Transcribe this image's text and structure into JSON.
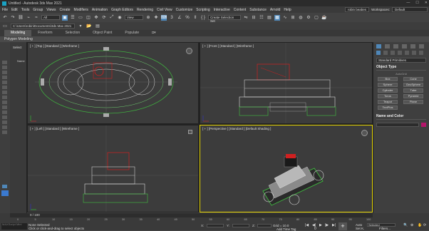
{
  "window": {
    "title": "Untitled - Autodesk 3ds Max 2021",
    "controls": [
      "—",
      "☐",
      "✕"
    ]
  },
  "menu": {
    "items": [
      "File",
      "Edit",
      "Tools",
      "Group",
      "Views",
      "Create",
      "Modifiers",
      "Animation",
      "Graph Editors",
      "Rendering",
      "Civil View",
      "Customize",
      "Scripting",
      "Interactive",
      "Content",
      "Substance",
      "Arnold",
      "Help"
    ],
    "user": "robin beabes",
    "workspace_label": "Workspaces:",
    "workspace_value": "Default"
  },
  "toolbar": {
    "filter_value": "All",
    "view_value": "View",
    "selection_set_placeholder": "Create Selection Set"
  },
  "project": {
    "path": "C:\\Users\\robin\\Documents\\3ds Max 2021"
  },
  "ribbon": {
    "tabs": [
      "Modeling",
      "Freeform",
      "Selection",
      "Object Paint",
      "Populate"
    ],
    "active_tab": "Modeling",
    "sub_label": "Polygon Modeling"
  },
  "scene_explorer": {
    "tag": "Select",
    "name_header": "Name"
  },
  "viewports": {
    "top_label": "[ + ] [Top ] [Standard ] [Wireframe ]",
    "front_label": "[ + ] [Front ] [Standard ] [Wireframe ]",
    "left_label": "[ + ] [Left ] [Standard ] [Wireframe ]",
    "persp_label": "[ + ] [Perspective ] [Standard ] [Default Shading ]"
  },
  "command_panel": {
    "category": "Standard Primitives",
    "object_type_title": "Object Type",
    "autogrid": "AutoGrid",
    "buttons": [
      "Box",
      "Cone",
      "Sphere",
      "GeoSphere",
      "Cylinder",
      "Tube",
      "Torus",
      "Pyramid",
      "Teapot",
      "Plane",
      "TextPlus"
    ],
    "name_color_title": "Name and Color",
    "swatch_color": "#b4166a"
  },
  "timeline": {
    "frame_display": "0 / 100",
    "ticks": [
      "0",
      "5",
      "10",
      "15",
      "20",
      "25",
      "30",
      "35",
      "40",
      "45",
      "50",
      "55",
      "60",
      "65",
      "70",
      "75",
      "80",
      "85",
      "90",
      "95",
      "100"
    ]
  },
  "status": {
    "maxscript": "MAXScript Mini",
    "selection": "None Selected",
    "prompt": "Click or click-and-drag to select objects",
    "x_label": "X:",
    "y_label": "Y:",
    "z_label": "Z:",
    "grid": "Grid = 10.0",
    "time_tag": "Add Time Tag",
    "auto_key": "Auto",
    "set_key": "Set K.",
    "selected_value": "Selected",
    "filters": "Filters...",
    "frame_value": "0"
  }
}
